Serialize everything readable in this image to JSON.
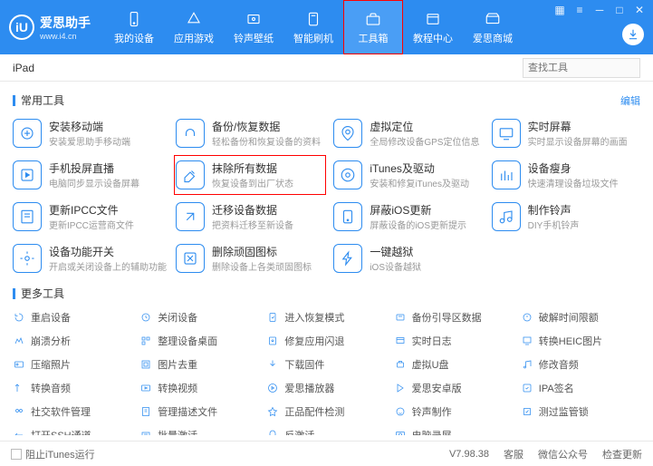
{
  "logo": {
    "name": "爱思助手",
    "url": "www.i4.cn",
    "mark": "iU"
  },
  "nav": [
    {
      "label": "我的设备"
    },
    {
      "label": "应用游戏"
    },
    {
      "label": "铃声壁纸"
    },
    {
      "label": "智能刷机"
    },
    {
      "label": "工具箱",
      "active": true,
      "hl": true
    },
    {
      "label": "教程中心"
    },
    {
      "label": "爱思商城"
    }
  ],
  "sub": {
    "tab": "iPad",
    "search_ph": "查找工具"
  },
  "sec1": {
    "title": "常用工具",
    "edit": "编辑"
  },
  "tools": [
    {
      "t": "安装移动端",
      "d": "安装爱思助手移动端"
    },
    {
      "t": "备份/恢复数据",
      "d": "轻松备份和恢复设备的资料"
    },
    {
      "t": "虚拟定位",
      "d": "全局修改设备GPS定位信息"
    },
    {
      "t": "实时屏幕",
      "d": "实时显示设备屏幕的画面"
    },
    {
      "t": "手机投屏直播",
      "d": "电脑同步显示设备屏幕"
    },
    {
      "t": "抹除所有数据",
      "d": "恢复设备到出厂状态",
      "hl": true
    },
    {
      "t": "iTunes及驱动",
      "d": "安装和修复iTunes及驱动"
    },
    {
      "t": "设备瘦身",
      "d": "快速清理设备垃圾文件"
    },
    {
      "t": "更新IPCC文件",
      "d": "更新IPCC运营商文件"
    },
    {
      "t": "迁移设备数据",
      "d": "把资料迁移至新设备"
    },
    {
      "t": "屏蔽iOS更新",
      "d": "屏蔽设备的iOS更新提示"
    },
    {
      "t": "制作铃声",
      "d": "DIY手机铃声"
    },
    {
      "t": "设备功能开关",
      "d": "开启或关闭设备上的辅助功能"
    },
    {
      "t": "删除顽固图标",
      "d": "删除设备上各类顽固图标"
    },
    {
      "t": "一键越狱",
      "d": "iOS设备越狱"
    }
  ],
  "sec2": {
    "title": "更多工具"
  },
  "more": [
    "重启设备",
    "关闭设备",
    "进入恢复模式",
    "备份引导区数据",
    "破解时间限额",
    "崩溃分析",
    "整理设备桌面",
    "修复应用闪退",
    "实时日志",
    "转换HEIC图片",
    "压缩照片",
    "图片去重",
    "下载固件",
    "虚拟U盘",
    "修改音频",
    "转换音频",
    "转换视频",
    "爱思播放器",
    "爱思安卓版",
    "IPA签名",
    "社交软件管理",
    "管理描述文件",
    "正品配件检测",
    "铃声制作",
    "测过监管锁",
    "打开SSH通道",
    "批量激活",
    "反激活",
    "电脑录屏"
  ],
  "footer": {
    "chk": "阻止iTunes运行",
    "ver": "V7.98.38",
    "l1": "客服",
    "l2": "微信公众号",
    "l3": "检查更新"
  }
}
